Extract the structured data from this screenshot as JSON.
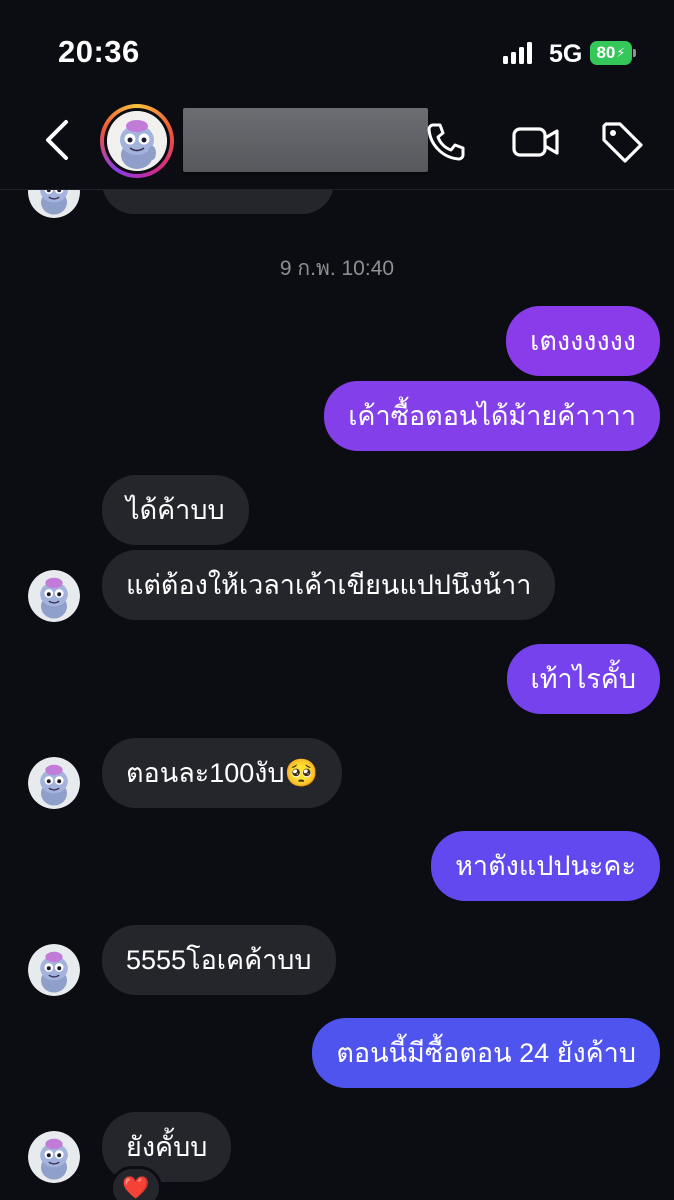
{
  "status_bar": {
    "time": "20:36",
    "network": "5G",
    "battery": "80"
  },
  "header": {
    "back_icon": "chevron-left-icon",
    "call_icon": "phone-icon",
    "video_icon": "video-camera-icon",
    "tag_icon": "tag-icon"
  },
  "conversation": {
    "timestamp": "9 ก.พ. 10:40",
    "messages": [
      {
        "sender": "me",
        "text": "เตงงงงงง"
      },
      {
        "sender": "me",
        "text": "เค้าซื้อตอนได้ม้ายค้าาาา"
      },
      {
        "sender": "them",
        "text": "ได้ค้าบบ"
      },
      {
        "sender": "them",
        "text": "แต่ต้องให้เวลาเค้าเขียนแปปนึงน้าา"
      },
      {
        "sender": "me",
        "text": "เท้าไรคั้บ"
      },
      {
        "sender": "them",
        "text": "ตอนละ100งับ🥺"
      },
      {
        "sender": "me",
        "text": "หาตังแปปนะคะ"
      },
      {
        "sender": "them",
        "text": "5555โอเคค้าบบ"
      },
      {
        "sender": "me",
        "text": "ตอนนี้มีซื้อตอน 24 ยังค้าบ"
      },
      {
        "sender": "them",
        "text": "ยังคั้บบ"
      }
    ],
    "reaction": "❤️"
  },
  "colors": {
    "background": "#0c0d12",
    "incoming_bubble": "#25262b",
    "outgoing_top": "#8a3be6",
    "outgoing_bottom": "#4f5ef0"
  }
}
